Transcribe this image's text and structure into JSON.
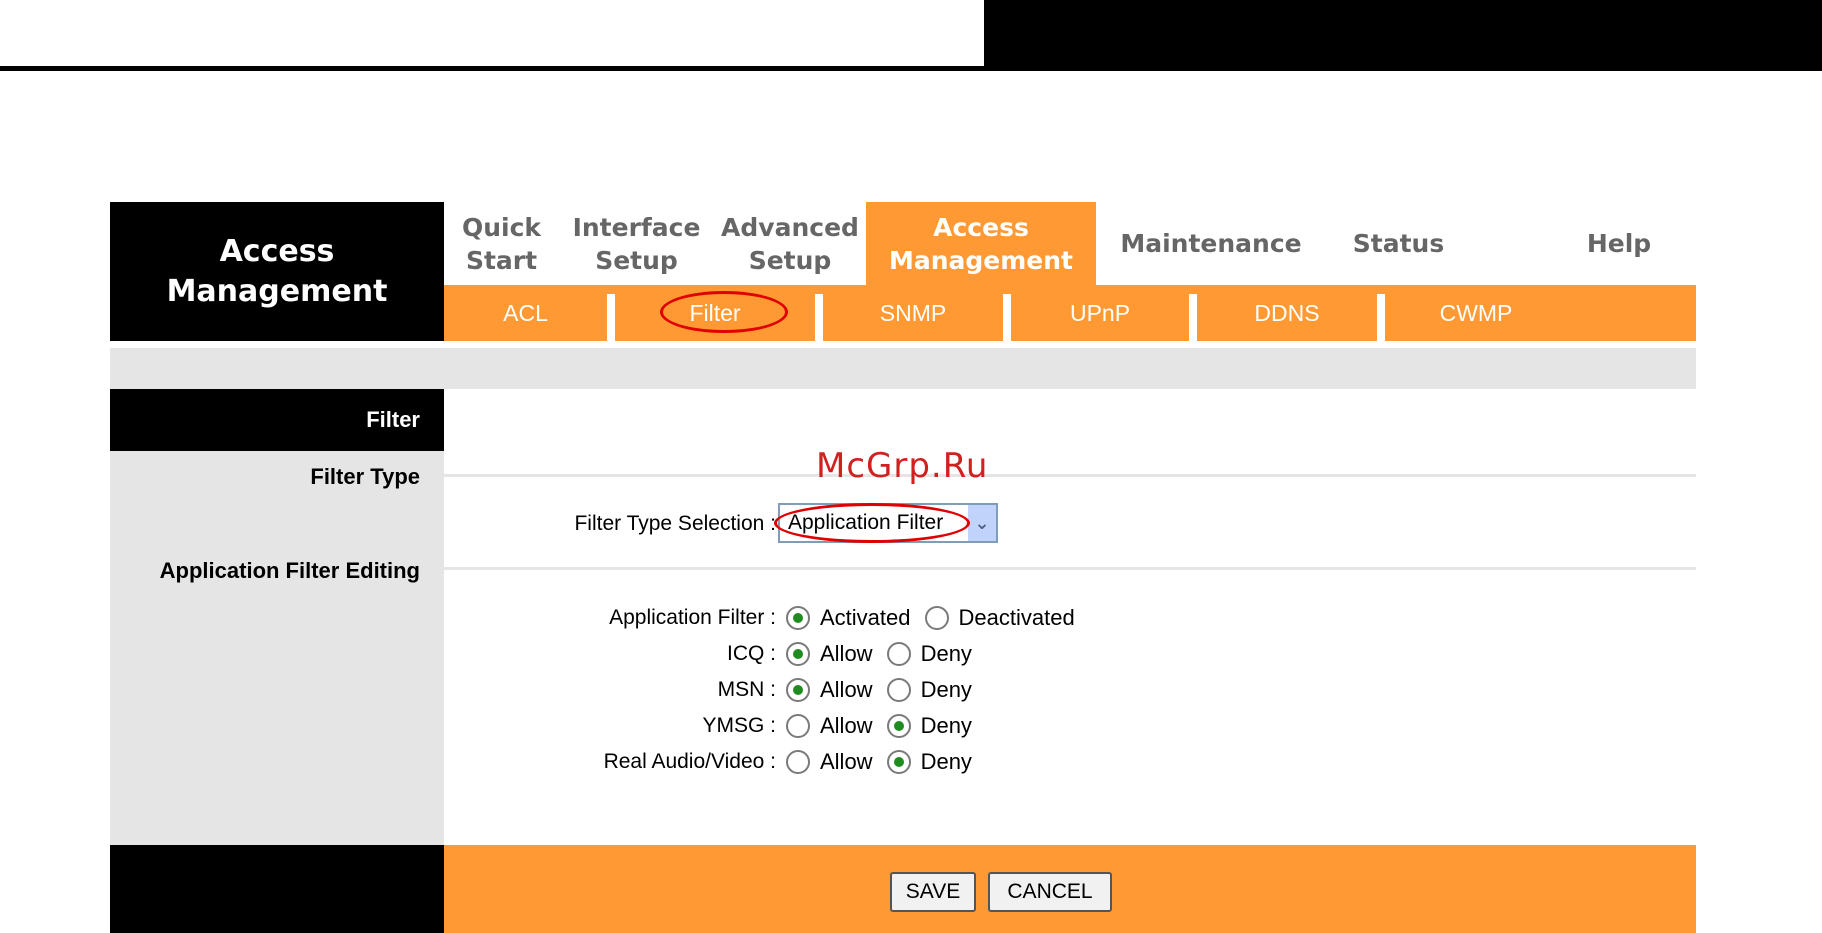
{
  "brand": {
    "title": "Access\nManagement"
  },
  "main_nav": [
    {
      "label": "Quick\nStart",
      "active": false
    },
    {
      "label": "Interface\nSetup",
      "active": false
    },
    {
      "label": "Advanced\nSetup",
      "active": false
    },
    {
      "label": "Access\nManagement",
      "active": true
    },
    {
      "label": "Maintenance",
      "active": false
    },
    {
      "label": "Status",
      "active": false
    },
    {
      "label": "Help",
      "active": false
    }
  ],
  "sub_nav": [
    {
      "label": "ACL",
      "active": false
    },
    {
      "label": "Filter",
      "active": true
    },
    {
      "label": "SNMP",
      "active": false
    },
    {
      "label": "UPnP",
      "active": false
    },
    {
      "label": "DDNS",
      "active": false
    },
    {
      "label": "CWMP",
      "active": false
    }
  ],
  "section": {
    "heading": "Filter",
    "filter_type_label": "Filter Type",
    "app_filter_editing_label": "Application Filter Editing"
  },
  "filter_type": {
    "label": "Filter Type Selection :",
    "selected": "Application Filter"
  },
  "app_filter": {
    "label": "Application Filter :",
    "options": [
      "Activated",
      "Deactivated"
    ],
    "selected": "Activated"
  },
  "rules": [
    {
      "label": "ICQ :",
      "options": [
        "Allow",
        "Deny"
      ],
      "selected": "Allow"
    },
    {
      "label": "MSN :",
      "options": [
        "Allow",
        "Deny"
      ],
      "selected": "Allow"
    },
    {
      "label": "YMSG :",
      "options": [
        "Allow",
        "Deny"
      ],
      "selected": "Deny"
    },
    {
      "label": "Real Audio/Video :",
      "options": [
        "Allow",
        "Deny"
      ],
      "selected": "Deny"
    }
  ],
  "buttons": {
    "save": "SAVE",
    "cancel": "CANCEL"
  },
  "watermark": "McGrp.Ru",
  "colors": {
    "accent": "#ff9933",
    "header_bg": "#000000",
    "panel_gray": "#e5e5e5",
    "highlight": "#e00000"
  }
}
